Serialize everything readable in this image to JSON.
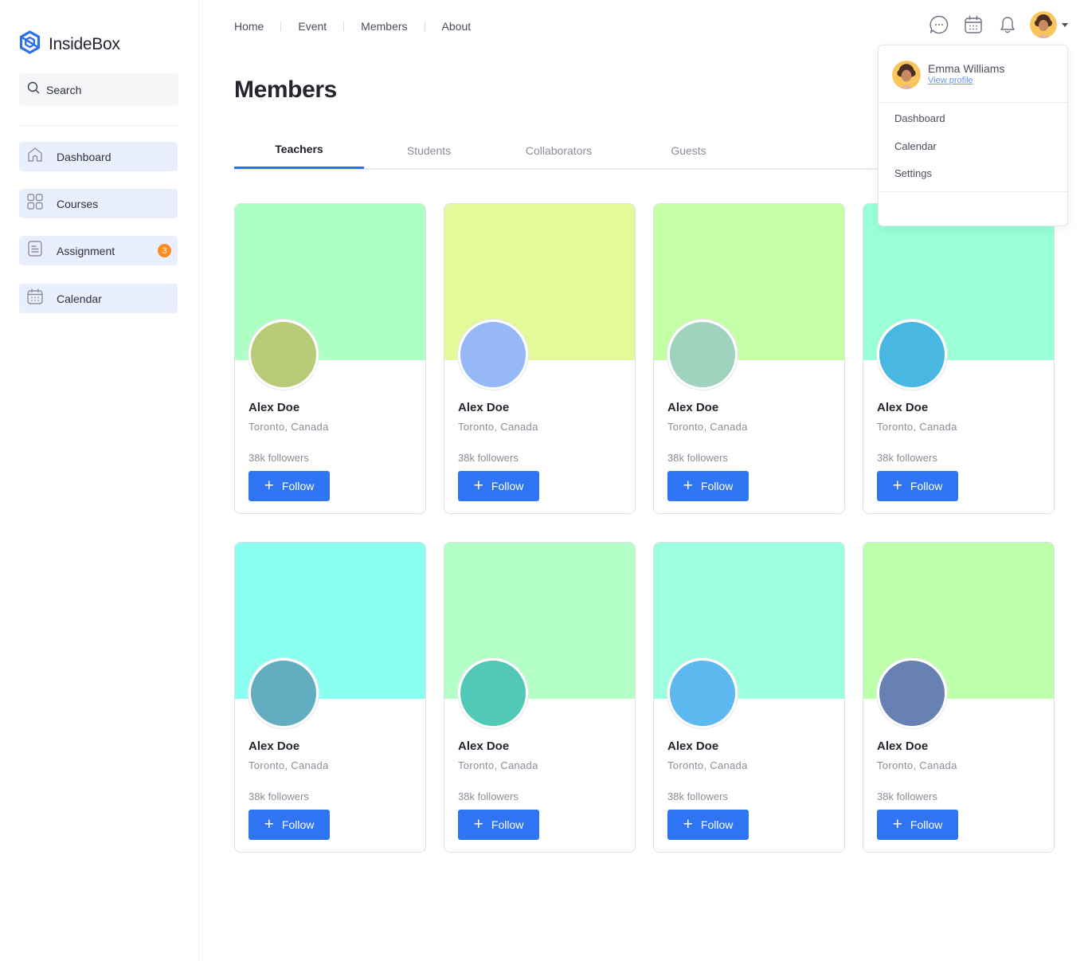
{
  "app": {
    "brand": "InsideBox",
    "brand_color": "#2f6fe9"
  },
  "sidebar": {
    "search_placeholder": "Search",
    "items": [
      {
        "label": "Dashboard",
        "icon": "home-icon"
      },
      {
        "label": "Courses",
        "icon": "grid-icon"
      },
      {
        "label": "Assignment",
        "icon": "document-icon",
        "badge": "3"
      },
      {
        "label": "Calendar",
        "icon": "calendar-icon"
      }
    ]
  },
  "topnav": {
    "links": [
      "Home",
      "Event",
      "Members",
      "About"
    ]
  },
  "header_icons": [
    "chat-icon",
    "calendar-icon",
    "bell-icon"
  ],
  "page": {
    "title": "Members"
  },
  "tabs": [
    {
      "label": "Teachers",
      "active": true
    },
    {
      "label": "Students",
      "active": false
    },
    {
      "label": "Collaborators",
      "active": false
    },
    {
      "label": "Guests",
      "active": false
    }
  ],
  "cards": [
    {
      "name": "Alex Doe",
      "location": "Toronto, Canada",
      "followers": "38k followers",
      "follow_label": "Follow",
      "cover_color": "#adffc3",
      "avatar_color": "#b9cb77"
    },
    {
      "name": "Alex Doe",
      "location": "Toronto, Canada",
      "followers": "38k followers",
      "follow_label": "Follow",
      "cover_color": "#e3f99a",
      "avatar_color": "#96b8f7"
    },
    {
      "name": "Alex Doe",
      "location": "Toronto, Canada",
      "followers": "38k followers",
      "follow_label": "Follow",
      "cover_color": "#c4ffa5",
      "avatar_color": "#9fd3bd"
    },
    {
      "name": "Alex Doe",
      "location": "Toronto, Canada",
      "followers": "38k followers",
      "follow_label": "Follow",
      "cover_color": "#98ffd6",
      "avatar_color": "#48b8e2"
    },
    {
      "name": "Alex Doe",
      "location": "Toronto, Canada",
      "followers": "38k followers",
      "follow_label": "Follow",
      "cover_color": "#8afff0",
      "avatar_color": "#62aec0"
    },
    {
      "name": "Alex Doe",
      "location": "Toronto, Canada",
      "followers": "38k followers",
      "follow_label": "Follow",
      "cover_color": "#b4ffc7",
      "avatar_color": "#51c9b6"
    },
    {
      "name": "Alex Doe",
      "location": "Toronto, Canada",
      "followers": "38k followers",
      "follow_label": "Follow",
      "cover_color": "#9cffe0",
      "avatar_color": "#5cb8ee"
    },
    {
      "name": "Alex Doe",
      "location": "Toronto, Canada",
      "followers": "38k followers",
      "follow_label": "Follow",
      "cover_color": "#bdffaa",
      "avatar_color": "#6881b4"
    }
  ],
  "dropdown": {
    "user_name": "Emma Williams",
    "profile_link": "View profile",
    "items": [
      "Dashboard",
      "Calendar",
      "Settings"
    ]
  }
}
